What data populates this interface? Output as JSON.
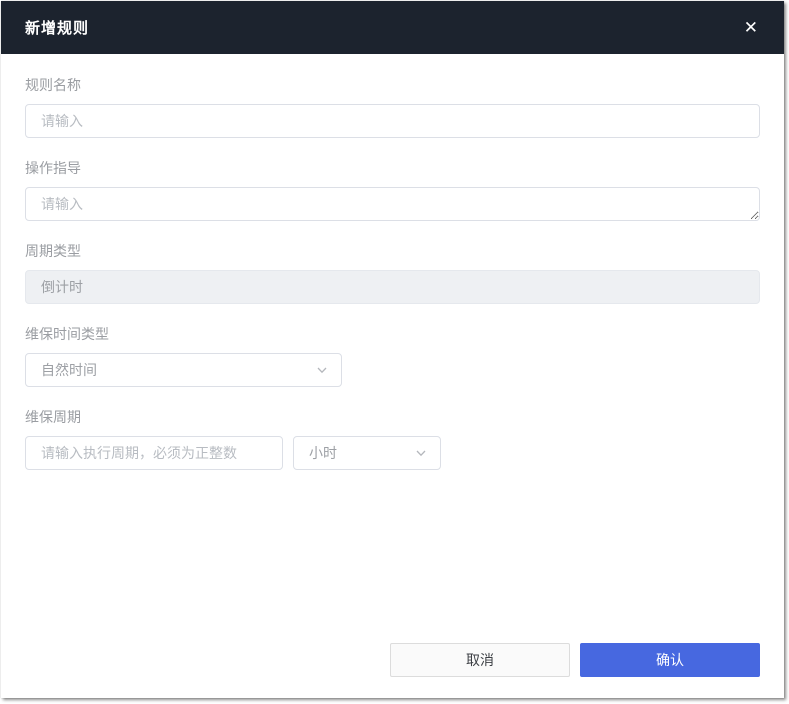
{
  "dialog": {
    "title": "新增规则"
  },
  "icons": {
    "close": "✕"
  },
  "form": {
    "fields": [
      {
        "label": "规则名称",
        "placeholder": "请输入",
        "type": "input"
      },
      {
        "label": "操作指导",
        "placeholder": "请输入",
        "type": "textarea"
      },
      {
        "label": "周期类型",
        "value": "倒计时",
        "type": "disabled-input"
      },
      {
        "label": "维保时间类型",
        "value": "自然时间",
        "type": "select"
      },
      {
        "label": "维保周期",
        "placeholder": "请输入执行周期，必须为正整数",
        "unit_value": "小时",
        "type": "input-with-unit-select"
      }
    ]
  },
  "footer": {
    "cancel_label": "取消",
    "confirm_label": "确认"
  },
  "colors": {
    "header_bg": "#1c232e",
    "primary_blue": "#4768e0",
    "label_gray": "#9a9da2"
  }
}
